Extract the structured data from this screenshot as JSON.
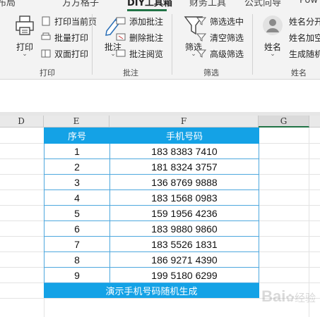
{
  "ribbon": {
    "tabs": [
      "布局",
      "方方格子",
      "DIY工具箱",
      "财务工具",
      "公式向导",
      "Pow"
    ],
    "active_tab_index": 2,
    "print_group": {
      "label": "打印",
      "big_button": "打印",
      "items": [
        "打印当前页",
        "批量打印",
        "双面打印"
      ]
    },
    "comment_group": {
      "label": "批注",
      "big_button": "批注",
      "items": [
        "添加批注",
        "删除批注",
        "批注阅览"
      ]
    },
    "filter_group": {
      "label": "筛选",
      "big_button": "筛选",
      "items": [
        "筛选选中",
        "清空筛选",
        "高级筛选"
      ]
    },
    "name_group": {
      "label": "姓名",
      "big_button": "姓名",
      "items": [
        "姓名分开",
        "姓名加空",
        "生成随机"
      ]
    },
    "caret": "⌄"
  },
  "sheet": {
    "columns": [
      "D",
      "E",
      "F",
      "G"
    ],
    "selected_column": "G",
    "table": {
      "headers": [
        "序号",
        "手机号码"
      ],
      "rows": [
        [
          "1",
          "183 8383 7410"
        ],
        [
          "2",
          "181 8324 3757"
        ],
        [
          "3",
          "136 8769 9888"
        ],
        [
          "4",
          "183 1568 0983"
        ],
        [
          "5",
          "159 1956 4236"
        ],
        [
          "6",
          "183 9880 9860"
        ],
        [
          "7",
          "183 5526 1831"
        ],
        [
          "8",
          "186 9271 4390"
        ],
        [
          "9",
          "199 5180 6299"
        ]
      ],
      "footer": "演示手机号码随机生成"
    }
  },
  "colors": {
    "accent": "#217346",
    "table_header": "#14a2e6",
    "table_border": "#4ea8de"
  },
  "watermark": {
    "brand": "Bai",
    "suffix": "经验"
  }
}
